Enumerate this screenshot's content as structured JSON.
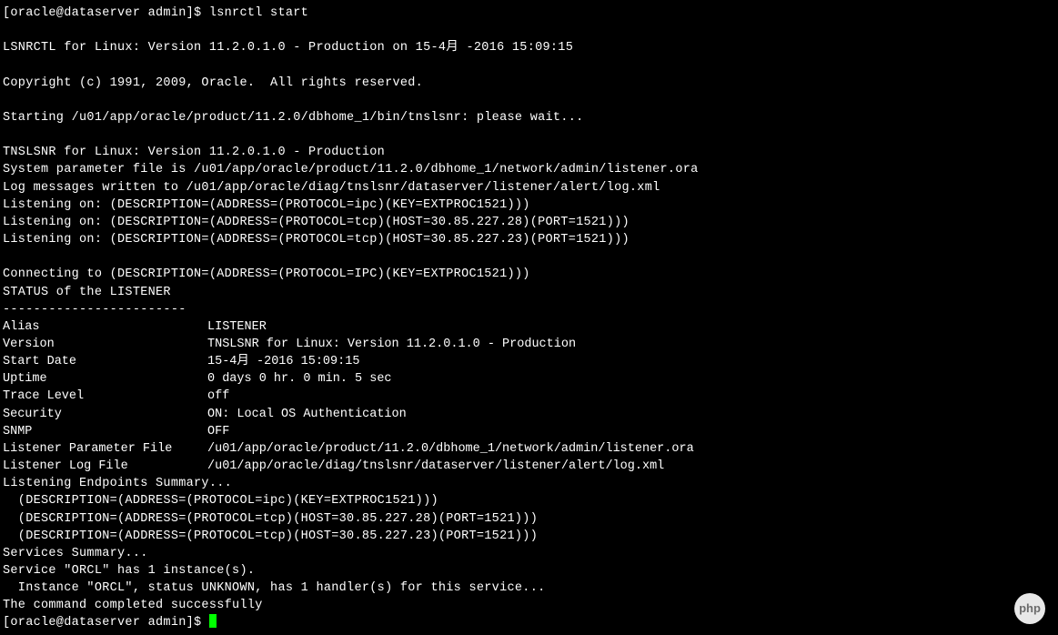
{
  "prompt1": "[oracle@dataserver admin]$ ",
  "command": "lsnrctl start",
  "prompt2": "[oracle@dataserver admin]$ ",
  "header_version": "LSNRCTL for Linux: Version 11.2.0.1.0 - Production on 15-4月 -2016 15:09:15",
  "copyright": "Copyright (c) 1991, 2009, Oracle.  All rights reserved.",
  "starting": "Starting /u01/app/oracle/product/11.2.0/dbhome_1/bin/tnslsnr: please wait...",
  "tnslsnr_version": "TNSLSNR for Linux: Version 11.2.0.1.0 - Production",
  "system_param": "System parameter file is /u01/app/oracle/product/11.2.0/dbhome_1/network/admin/listener.ora",
  "log_messages": "Log messages written to /u01/app/oracle/diag/tnslsnr/dataserver/listener/alert/log.xml",
  "listening_on_1": "Listening on: (DESCRIPTION=(ADDRESS=(PROTOCOL=ipc)(KEY=EXTPROC1521)))",
  "listening_on_2": "Listening on: (DESCRIPTION=(ADDRESS=(PROTOCOL=tcp)(HOST=30.85.227.28)(PORT=1521)))",
  "listening_on_3": "Listening on: (DESCRIPTION=(ADDRESS=(PROTOCOL=tcp)(HOST=30.85.227.23)(PORT=1521)))",
  "connecting_to": "Connecting to (DESCRIPTION=(ADDRESS=(PROTOCOL=IPC)(KEY=EXTPROC1521)))",
  "status_header": "STATUS of the LISTENER",
  "dashes": "------------------------",
  "status": {
    "alias_k": "Alias",
    "alias_v": "LISTENER",
    "version_k": "Version",
    "version_v": "TNSLSNR for Linux: Version 11.2.0.1.0 - Production",
    "startdate_k": "Start Date",
    "startdate_v": "15-4月 -2016 15:09:15",
    "uptime_k": "Uptime",
    "uptime_v": "0 days 0 hr. 0 min. 5 sec",
    "trace_k": "Trace Level",
    "trace_v": "off",
    "security_k": "Security",
    "security_v": "ON: Local OS Authentication",
    "snmp_k": "SNMP",
    "snmp_v": "OFF",
    "paramfile_k": "Listener Parameter File",
    "paramfile_v": "/u01/app/oracle/product/11.2.0/dbhome_1/network/admin/listener.ora",
    "logfile_k": "Listener Log File",
    "logfile_v": "/u01/app/oracle/diag/tnslsnr/dataserver/listener/alert/log.xml"
  },
  "endpoints_header": "Listening Endpoints Summary...",
  "endpoint_1": "  (DESCRIPTION=(ADDRESS=(PROTOCOL=ipc)(KEY=EXTPROC1521)))",
  "endpoint_2": "  (DESCRIPTION=(ADDRESS=(PROTOCOL=tcp)(HOST=30.85.227.28)(PORT=1521)))",
  "endpoint_3": "  (DESCRIPTION=(ADDRESS=(PROTOCOL=tcp)(HOST=30.85.227.23)(PORT=1521)))",
  "services_header": "Services Summary...",
  "service_line": "Service \"ORCL\" has 1 instance(s).",
  "instance_line": "  Instance \"ORCL\", status UNKNOWN, has 1 handler(s) for this service...",
  "completed": "The command completed successfully",
  "badge_text": "php"
}
